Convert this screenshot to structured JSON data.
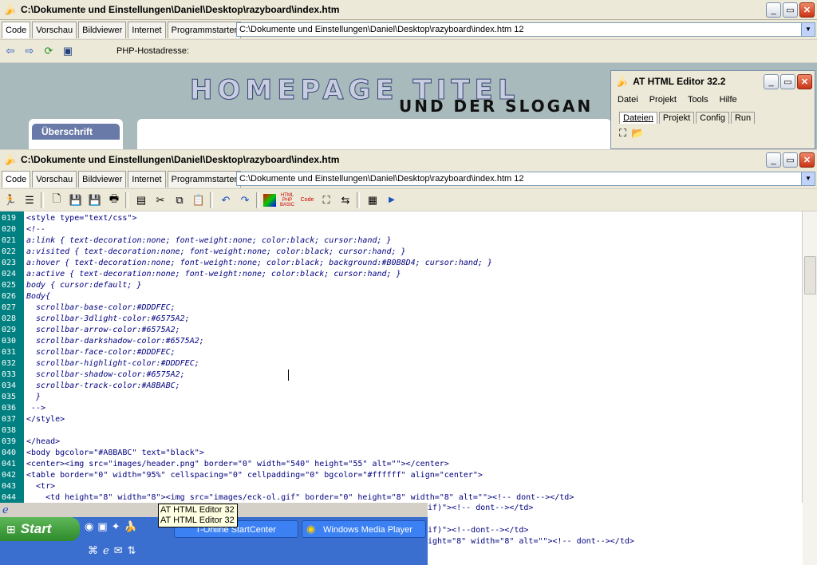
{
  "window1": {
    "title": "C:\\Dokumente und Einstellungen\\Daniel\\Desktop\\razyboard\\index.htm",
    "tabs": [
      "Code",
      "Vorschau",
      "Bildviewer",
      "Internet",
      "Programmstarter"
    ],
    "address": "C:\\Dokumente und Einstellungen\\Daniel\\Desktop\\razyboard\\index.htm 12",
    "php_label": "PHP-Hostadresse:"
  },
  "preview": {
    "banner_title": "HOMEPAGE TITEL",
    "banner_slogan": "UND DER SLOGAN",
    "heading": "Überschrift"
  },
  "at_window": {
    "title": "AT HTML Editor 32.2",
    "menu": [
      "Datei",
      "Projekt",
      "Tools",
      "Hilfe"
    ],
    "tabs": [
      "Dateien",
      "Projekt",
      "Config",
      "Run"
    ]
  },
  "window2": {
    "title": "C:\\Dokumente und Einstellungen\\Daniel\\Desktop\\razyboard\\index.htm",
    "tabs": [
      "Code",
      "Vorschau",
      "Bildviewer",
      "Internet",
      "Programmstarter"
    ],
    "address": "C:\\Dokumente und Einstellungen\\Daniel\\Desktop\\razyboard\\index.htm 12",
    "toolbar_labels": {
      "html_php_basic": "HTML PHP BASIC",
      "code": "Code"
    }
  },
  "code_lines": [
    {
      "n": "019",
      "t": "<style type=\"text/css\">",
      "c": "tag"
    },
    {
      "n": "020",
      "t": "<!--",
      "c": "css"
    },
    {
      "n": "021",
      "t": "a:link { text-decoration:none; font-weight:none; color:black; cursor:hand; }",
      "c": "css"
    },
    {
      "n": "022",
      "t": "a:visited { text-decoration:none; font-weight:none; color:black; cursor:hand; }",
      "c": "css"
    },
    {
      "n": "023",
      "t": "a:hover { text-decoration:none; font-weight:none; color:black; background:#B0B8D4; cursor:hand; }",
      "c": "css"
    },
    {
      "n": "024",
      "t": "a:active { text-decoration:none; font-weight:none; color:black; cursor:hand; }",
      "c": "css"
    },
    {
      "n": "025",
      "t": "body { cursor:default; }",
      "c": "css"
    },
    {
      "n": "026",
      "t": "Body{",
      "c": "css"
    },
    {
      "n": "027",
      "t": "  scrollbar-base-color:#DDDFEC;",
      "c": "css"
    },
    {
      "n": "028",
      "t": "  scrollbar-3dlight-color:#6575A2;",
      "c": "css"
    },
    {
      "n": "029",
      "t": "  scrollbar-arrow-color:#6575A2;",
      "c": "css"
    },
    {
      "n": "030",
      "t": "  scrollbar-darkshadow-color:#6575A2;",
      "c": "css"
    },
    {
      "n": "031",
      "t": "  scrollbar-face-color:#DDDFEC;",
      "c": "css"
    },
    {
      "n": "032",
      "t": "  scrollbar-highlight-color:#DDDFEC;",
      "c": "css"
    },
    {
      "n": "033",
      "t": "  scrollbar-shadow-color:#6575A2;",
      "c": "css"
    },
    {
      "n": "034",
      "t": "  scrollbar-track-color:#A8BABC;",
      "c": "css"
    },
    {
      "n": "035",
      "t": "  }",
      "c": "css"
    },
    {
      "n": "036",
      "t": " -->",
      "c": "css"
    },
    {
      "n": "037",
      "t": "</style>",
      "c": "tag"
    },
    {
      "n": "038",
      "t": "",
      "c": "tag"
    },
    {
      "n": "039",
      "t": "</head>",
      "c": "tag"
    },
    {
      "n": "040",
      "t": "<body bgcolor=\"#A8BABC\" text=\"black\">",
      "c": "tag"
    },
    {
      "n": "041",
      "t": "<center><img src=\"images/header.png\" border=\"0\" width=\"540\" height=\"55\" alt=\"\"></center>",
      "c": "tag"
    },
    {
      "n": "042",
      "t": "<table border=\"0\" width=\"95%\" cellspacing=\"0\" cellpadding=\"0\" bgcolor=\"#ffffff\" align=\"center\">",
      "c": "tag"
    },
    {
      "n": "043",
      "t": "  <tr>",
      "c": "tag"
    },
    {
      "n": "044",
      "t": "    <td height=\"8\" width=\"8\"><img src=\"images/eck-ol.gif\" border=\"0\" height=\"8\" width=\"8\" alt=\"\"><!-- dont--></td>",
      "c": "tag"
    }
  ],
  "partial_lines": [
    "if)\"><!-- dont--></td>",
    "if)\"><!--dont--></td>",
    "ight=\"8\" width=\"8\" alt=\"\"><!-- dont--></td>"
  ],
  "taskbar": {
    "start": "Start",
    "tasks": [
      "T-Online StartCenter",
      "Windows Media Player"
    ],
    "tooltip_lines": [
      "AT HTML Editor 32",
      "AT HTML Editor 32"
    ]
  }
}
